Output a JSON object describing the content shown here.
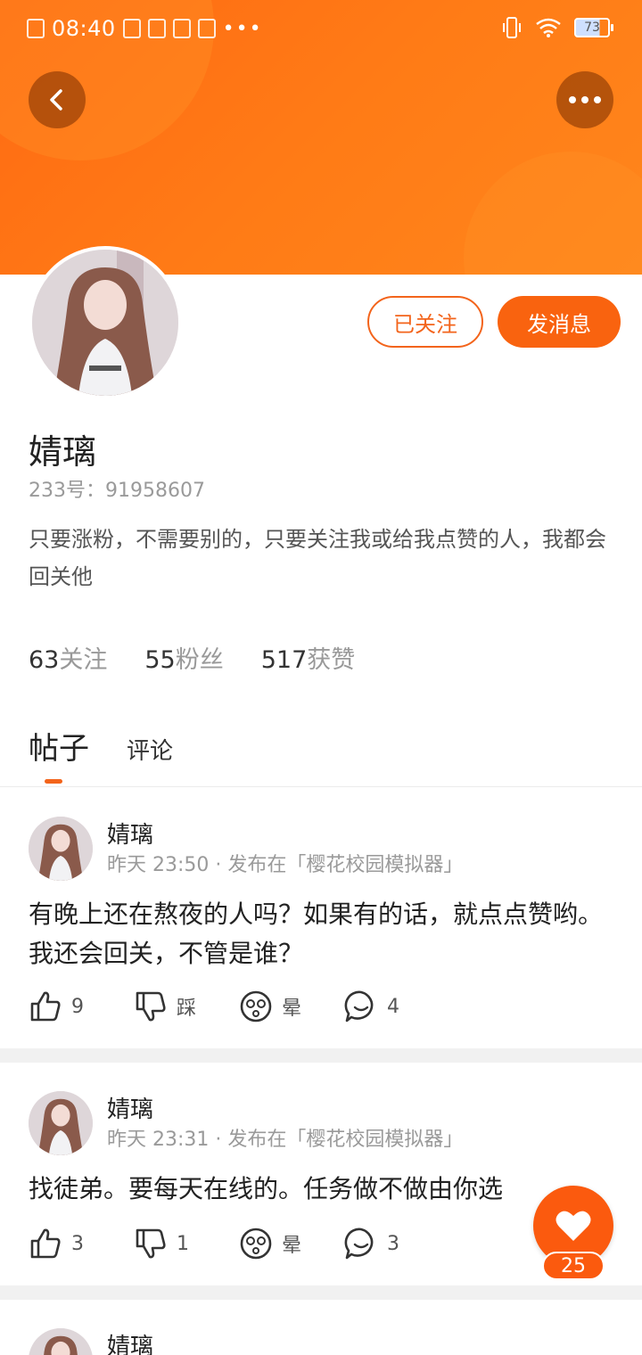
{
  "status_bar": {
    "time": "08:40",
    "battery": "73"
  },
  "profile": {
    "name": "婧璃",
    "uid": "233号：91958607",
    "bio": "只要涨粉，不需要别的，只要关注我或给我点赞的人，我都会回关他",
    "follow_label": "已关注",
    "message_label": "发消息",
    "stats": [
      {
        "num": "63",
        "label": "关注"
      },
      {
        "num": "55",
        "label": "粉丝"
      },
      {
        "num": "517",
        "label": "获赞"
      }
    ]
  },
  "tabs": {
    "posts": "帖子",
    "comments": "评论"
  },
  "posts": [
    {
      "author": "婧璃",
      "meta": "昨天 23:50 · 发布在「樱花校园模拟器」",
      "text": "有晚上还在熬夜的人吗？如果有的话，就点点赞哟。我还会回关，不管是谁？",
      "like": "9",
      "dislike": "踩",
      "dizzy": "晕",
      "comments": "4"
    },
    {
      "author": "婧璃",
      "meta": "昨天 23:31 · 发布在「樱花校园模拟器」",
      "text": "找徒弟。要每天在线的。任务做不做由你选",
      "like": "3",
      "dislike": "1",
      "dizzy": "晕",
      "comments": "3"
    },
    {
      "author": "婧璃"
    }
  ],
  "like_fab": {
    "count": "25"
  },
  "colors": {
    "accent": "#f9630f",
    "header": "#ff7416"
  },
  "icons": [
    "back-arrow-icon",
    "more-dots-icon",
    "thumb-up-icon",
    "thumb-down-icon",
    "dizzy-face-icon",
    "comment-bubble-icon",
    "heart-icon"
  ]
}
